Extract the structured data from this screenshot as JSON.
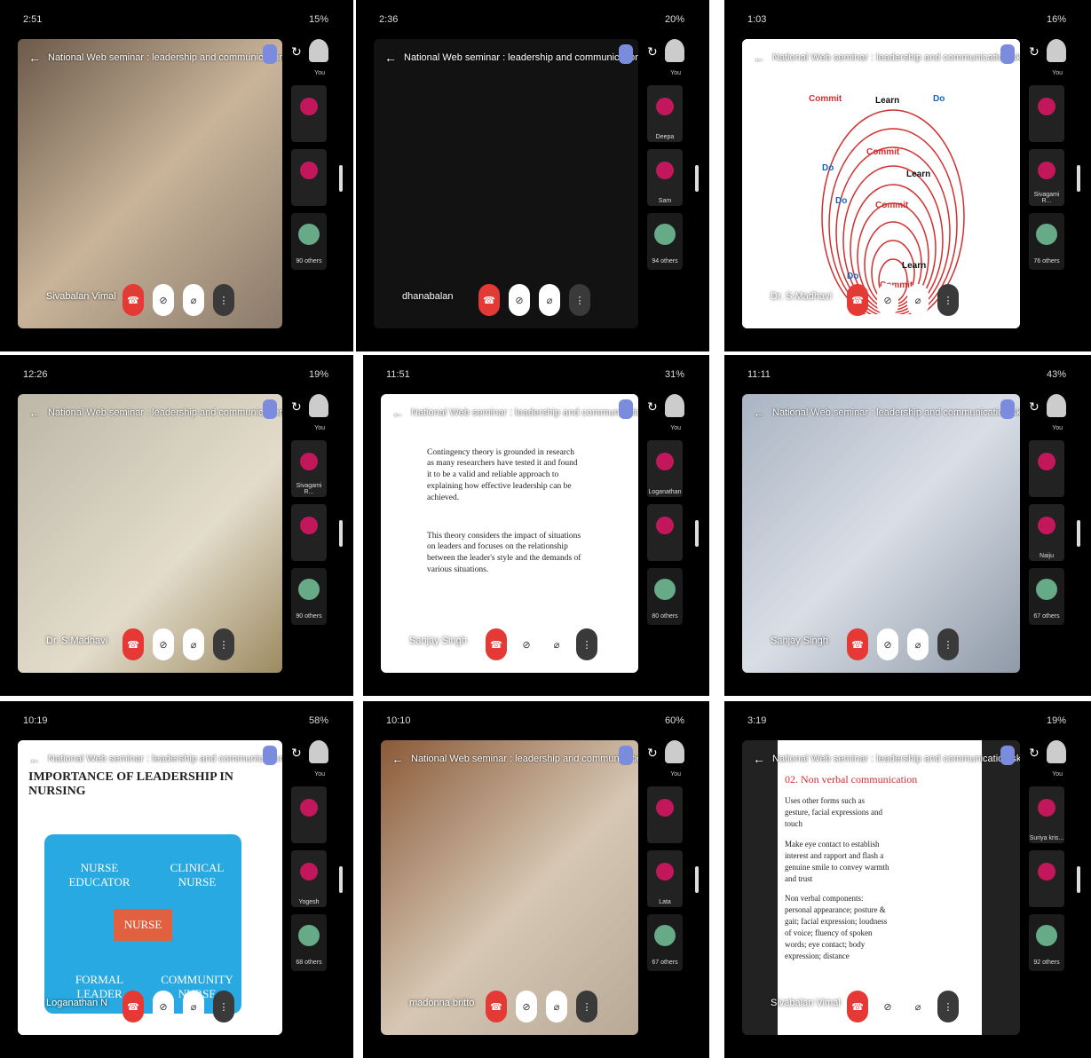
{
  "meeting_title": "National Web seminar : leadership and communication skills",
  "tiles": [
    {
      "time": "2:51",
      "battery": "15%",
      "speaker": "Sivabalan Vimal",
      "participants": [
        {
          "label": "You"
        },
        {
          "label": ""
        },
        {
          "label": ""
        }
      ],
      "others": "90 others"
    },
    {
      "time": "2:36",
      "battery": "20%",
      "speaker": "dhanabalan",
      "participants": [
        {
          "label": "You"
        },
        {
          "label": "Deepa"
        },
        {
          "label": "Sam"
        }
      ],
      "others": "94 others"
    },
    {
      "time": "1:03",
      "battery": "16%",
      "speaker": "Dr. S.Madhavi",
      "participants": [
        {
          "label": "You"
        },
        {
          "label": ""
        },
        {
          "label": "Sivagami R..."
        }
      ],
      "others": "76 others"
    },
    {
      "time": "12:26",
      "battery": "19%",
      "speaker": "Dr. S.Madhavi",
      "participants": [
        {
          "label": "You"
        },
        {
          "label": "Sivagami R..."
        },
        {
          "label": ""
        }
      ],
      "others": "90 others"
    },
    {
      "time": "11:51",
      "battery": "31%",
      "speaker": "Sanjay Singh",
      "participants": [
        {
          "label": "You"
        },
        {
          "label": "Loganathan"
        },
        {
          "label": ""
        }
      ],
      "others": "80 others"
    },
    {
      "time": "11:11",
      "battery": "43%",
      "speaker": "Sanjay Singh",
      "participants": [
        {
          "label": "You"
        },
        {
          "label": ""
        },
        {
          "label": "Naiju"
        }
      ],
      "others": "67 others"
    },
    {
      "time": "10:19",
      "battery": "58%",
      "speaker": "Loganathan N",
      "participants": [
        {
          "label": "You"
        },
        {
          "label": ""
        },
        {
          "label": "Yogesh"
        }
      ],
      "others": "68 others"
    },
    {
      "time": "10:10",
      "battery": "60%",
      "speaker": "madonna britto",
      "participants": [
        {
          "label": "You"
        },
        {
          "label": ""
        },
        {
          "label": "Lata"
        }
      ],
      "others": "67 others"
    },
    {
      "time": "3:19",
      "battery": "19%",
      "speaker": "Sivabalan Vimal",
      "participants": [
        {
          "label": "You"
        },
        {
          "label": "Suriya kris..."
        },
        {
          "label": ""
        }
      ],
      "others": "92 others"
    }
  ],
  "slides": {
    "spiral": {
      "words": [
        "Commit",
        "Learn",
        "Do",
        "Commit",
        "Do",
        "Learn",
        "Do",
        "Commit",
        "Do",
        "Learn",
        "Commit"
      ]
    },
    "contingency": {
      "p1": "Contingency theory is grounded in research as many researchers have tested it and found it to be a valid and reliable approach to explaining how effective leadership can be achieved.",
      "p2": "This theory considers the impact of situations on leaders and focuses on the relationship between the leader's style and the demands of various situations."
    },
    "nursing": {
      "title": "IMPORTANCE OF LEADERSHIP IN NURSING",
      "tl": "NURSE EDUCATOR",
      "tr": "CLINICAL NURSE",
      "center": "NURSE",
      "bl": "FORMAL LEADER",
      "br": "COMMUNITY NURSE"
    },
    "nonverbal": {
      "heading": "02. Non verbal communication",
      "b1": "Uses other forms such as gesture, facial expressions and touch",
      "b2": "Make eye contact to establish interest and rapport and flash a genuine smile to convey warmth and trust",
      "b3": "Non verbal components: personal appearance; posture & gait; facial expression; loudness of voice; fluency of spoken words; eye contact; body expression; distance"
    }
  },
  "colors": {
    "end_call": "#e53935",
    "accent": "#7b8cde",
    "slide_blue": "#29a9e1",
    "nurse_center": "#e06040",
    "spiral_red": "#d32f2f"
  }
}
